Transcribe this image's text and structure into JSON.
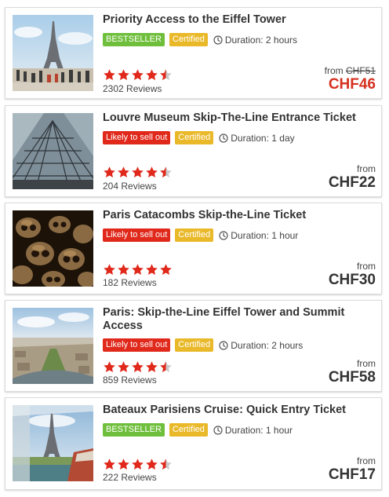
{
  "colors": {
    "bestseller": "#6fbf3c",
    "likely_to_sell_out": "#e0281b",
    "certified": "#e9b92a",
    "star": "#e0281b",
    "sale_price": "#d5301f"
  },
  "cards": [
    {
      "title": "Priority Access to the Eiffel Tower",
      "badge": "BESTSELLER",
      "badge_type": "bestseller",
      "certified": "Certified",
      "duration": "Duration: 2 hours",
      "rating": 4.5,
      "reviews": "2302 Reviews",
      "from": "from",
      "old_price": "CHF51",
      "price": "CHF46",
      "image": "eiffel-tower-crowd-photo"
    },
    {
      "title": "Louvre Museum Skip-The-Line Entrance Ticket",
      "badge": "Likely to sell out",
      "badge_type": "likely_to_sell_out",
      "certified": "Certified",
      "duration": "Duration: 1 day",
      "rating": 4.5,
      "reviews": "204 Reviews",
      "from": "from",
      "old_price": "",
      "price": "CHF22",
      "image": "louvre-pyramid-interior-photo"
    },
    {
      "title": "Paris Catacombs Skip-the-Line Ticket",
      "badge": "Likely to sell out",
      "badge_type": "likely_to_sell_out",
      "certified": "Certified",
      "duration": "Duration: 1 hour",
      "rating": 5,
      "reviews": "182 Reviews",
      "from": "from",
      "old_price": "",
      "price": "CHF30",
      "image": "catacombs-skulls-photo"
    },
    {
      "title": "Paris: Skip-the-Line Eiffel Tower and Summit Access",
      "badge": "Likely to sell out",
      "badge_type": "likely_to_sell_out",
      "certified": "Certified",
      "duration": "Duration: 2 hours",
      "rating": 4.5,
      "reviews": "859 Reviews",
      "from": "from",
      "old_price": "",
      "price": "CHF58",
      "image": "paris-aerial-view-photo"
    },
    {
      "title": "Bateaux Parisiens Cruise: Quick Entry Ticket",
      "badge": "BESTSELLER",
      "badge_type": "bestseller",
      "certified": "Certified",
      "duration": "Duration: 1 hour",
      "rating": 4.5,
      "reviews": "222 Reviews",
      "from": "from",
      "old_price": "",
      "price": "CHF17",
      "image": "seine-cruise-boat-photo"
    }
  ]
}
